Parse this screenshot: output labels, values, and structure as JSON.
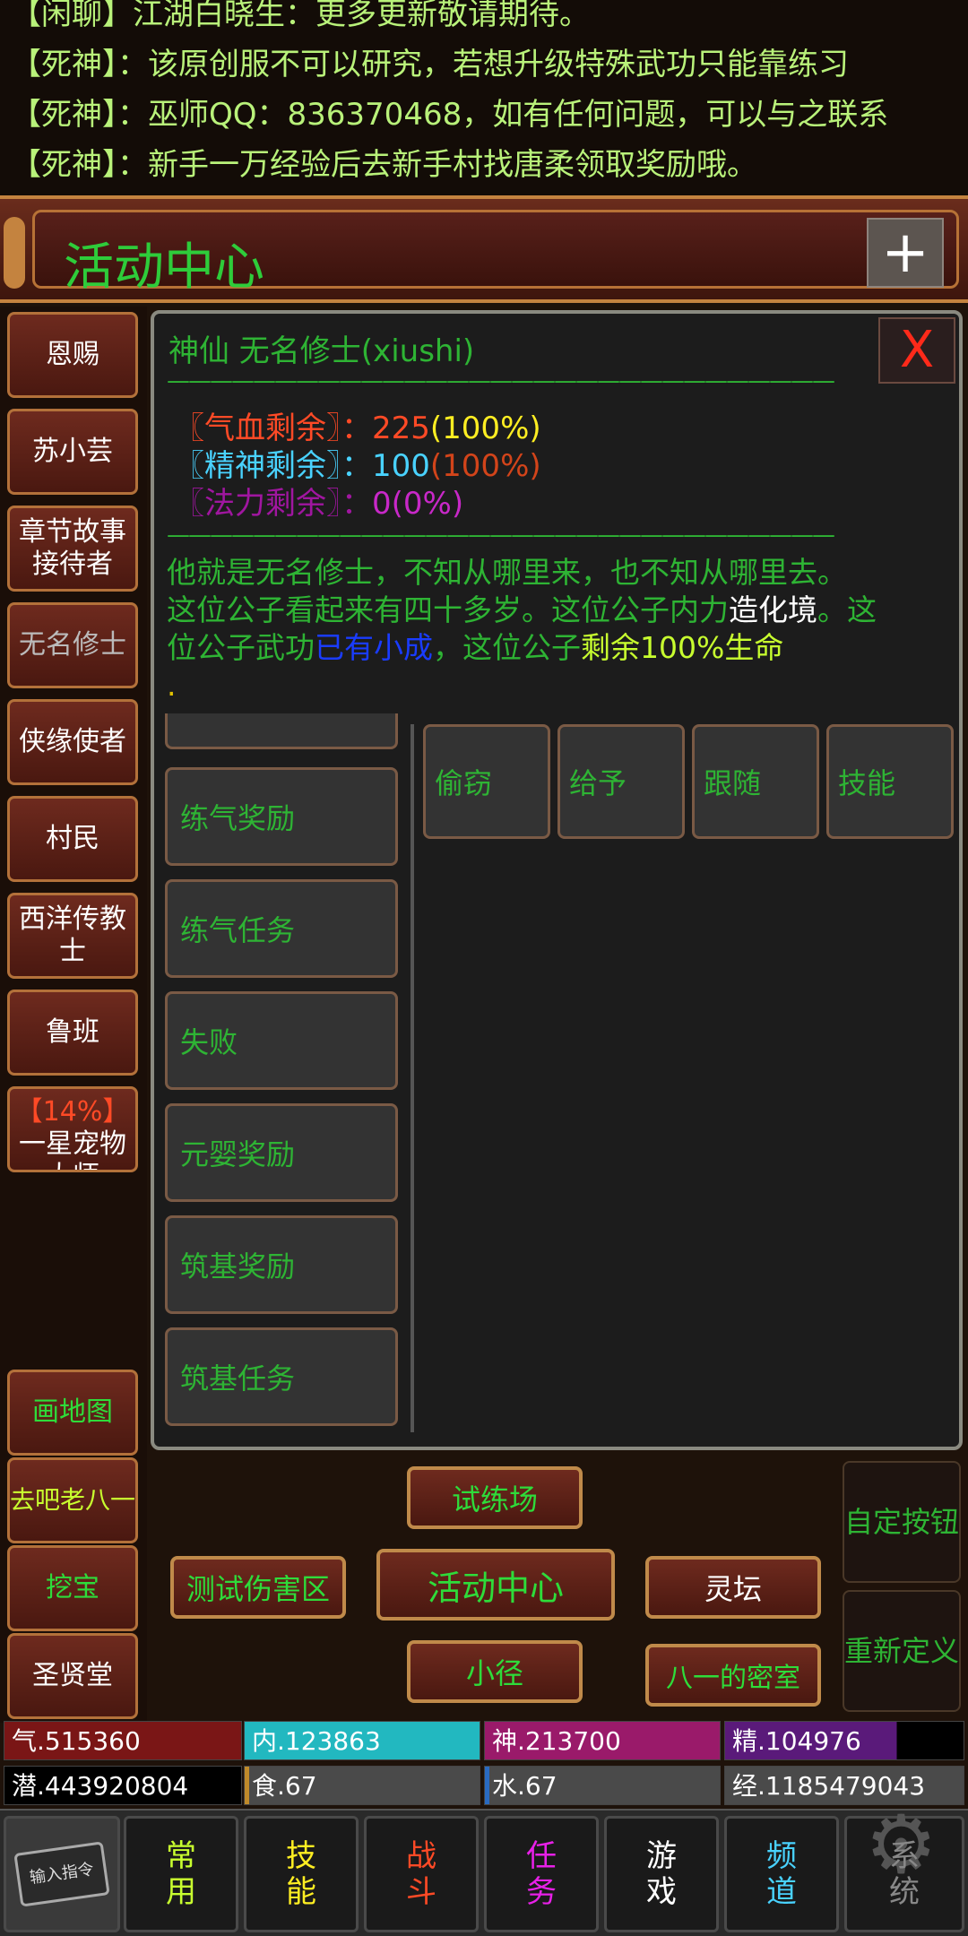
{
  "chat": [
    {
      "who": "【闲聊】",
      "text": "江湖白晓生：更多更新敬请期待。"
    },
    {
      "who": "【死神】",
      "text": "：该原创服不可以研究，若想升级特殊武功只能靠练习"
    },
    {
      "who": "【死神】",
      "text": "：巫师QQ：836370468，如有任何问题，可以与之联系"
    },
    {
      "who": "【死神】",
      "text": "：新手一万经验后去新手村找唐柔领取奖励哦。"
    }
  ],
  "header": {
    "title": "活动中心",
    "plus": "+"
  },
  "npc_list": [
    "恩赐",
    "苏小芸",
    "章节故事接待者",
    "无名修士",
    "侠缘使者",
    "村民",
    "西洋传教士",
    "鲁班"
  ],
  "pet_btn": {
    "pct": "【14%】",
    "label": "一星宠物大师"
  },
  "left_nav": [
    "画地图",
    "去吧老八一",
    "挖宝",
    "圣贤堂"
  ],
  "panel": {
    "npc_name": "神仙 无名修士(xiushi)",
    "close": "X",
    "dashes": "———————————————————————————————",
    "hp_label": "〖气血剩余〗：",
    "hp_val": "225",
    "hp_pct": "(100%)",
    "sp_label": "〖精神剩余〗：",
    "sp_val": "100",
    "sp_pct": "(100%)",
    "mp_label": "〖法力剩余〗：",
    "mp_val": "0",
    "mp_pct": "(0%)",
    "desc1": "他就是无名修士，不知从哪里来，也不知从哪里去。",
    "desc2a": "这位公子看起来有四十多岁。这位公子内力",
    "desc2b": "造化境",
    "desc2c": "。这",
    "desc3a": "位公子武功",
    "desc3b": "已有小成",
    "desc3c": "，这位公子",
    "desc3d": "剩余100%生命",
    "desc4": ".",
    "left_actions": [
      "练气奖励",
      "练气任务",
      "失败",
      "元婴奖励",
      "筑基奖励",
      "筑基任务"
    ],
    "ops": [
      "偷窃",
      "给予",
      "跟随",
      "技能"
    ]
  },
  "nav": {
    "trial": "试练场",
    "test": "测试伤害区",
    "center": "活动中心",
    "altar": "灵坛",
    "path": "小径",
    "secret": "八一的密室",
    "custom": "自定按钮",
    "redefine": "重新定义"
  },
  "bars": {
    "qi": "气.515360",
    "nei": "内.123863",
    "shen": "神.213700",
    "jing": "精.104976",
    "qian": "潜.443920804",
    "shi": "食.67",
    "shui": "水.67",
    "exp": "经.1185479043"
  },
  "tabs": {
    "input": "输入指令",
    "common": "常用",
    "skill": "技能",
    "fight": "战斗",
    "task": "任务",
    "game": "游戏",
    "channel": "频道",
    "system": "系统"
  },
  "colors": {
    "accent": "#2eb434",
    "frame": "#c4833f",
    "hp": "#ff4a26",
    "sp": "#49d2ff",
    "mp": "#c828c8"
  }
}
